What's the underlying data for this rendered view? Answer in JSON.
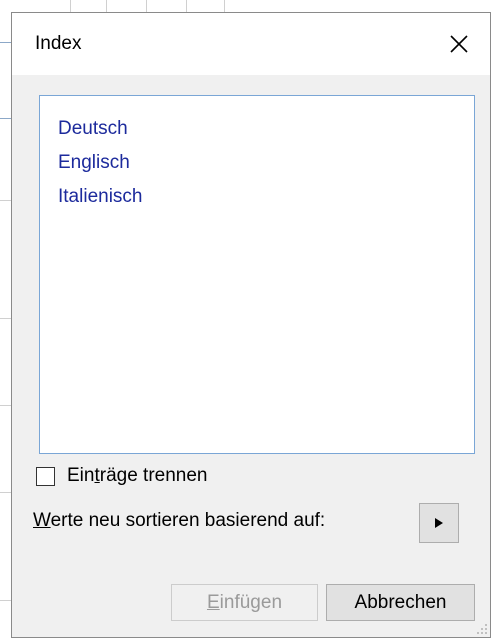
{
  "dialog": {
    "title": "Index",
    "close_icon": "close-icon"
  },
  "languages": [
    "Deutsch",
    "Englisch",
    "Italienisch"
  ],
  "separate_entries": {
    "label_pre": "Ein",
    "label_mnemonic": "t",
    "label_post": "räge trennen",
    "checked": false
  },
  "resort": {
    "label_mnemonic": "W",
    "label_post": "erte neu sortieren basierend auf:",
    "button_icon": "triangle-right-icon"
  },
  "buttons": {
    "insert_mnemonic": "E",
    "insert_post": "infügen",
    "insert_enabled": false,
    "cancel": "Abbrechen"
  },
  "colors": {
    "list_text": "#1c2a9c",
    "list_border": "#7aa6d6",
    "dialog_bg": "#f0f0f0",
    "disabled_text": "#9a9a9a"
  }
}
